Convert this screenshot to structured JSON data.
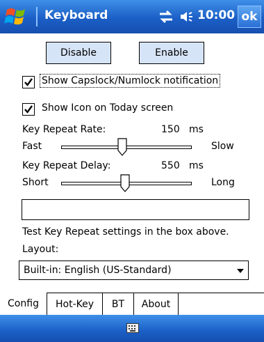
{
  "titlebar": {
    "title": "Keyboard",
    "time": "10:00",
    "ok_label": "ok",
    "icons": [
      "windows-start-icon",
      "connectivity-icon",
      "speaker-icon"
    ]
  },
  "buttons": {
    "disable": "Disable",
    "enable": "Enable"
  },
  "checkboxes": [
    {
      "label": "Show Capslock/Numlock notification",
      "checked": true
    },
    {
      "label": "Show Icon on Today screen",
      "checked": true
    }
  ],
  "repeat_rate": {
    "label": "Key Repeat Rate:",
    "value": "150",
    "unit": "ms",
    "min_label": "Fast",
    "max_label": "Slow",
    "level": 0.47
  },
  "repeat_delay": {
    "label": "Key Repeat Delay:",
    "value": "550",
    "unit": "ms",
    "min_label": "Short",
    "max_label": "Long",
    "level": 0.49
  },
  "test_box": {
    "value": "",
    "hint": "Test Key Repeat settings in the box above."
  },
  "layout": {
    "label": "Layout:",
    "selected": "Built-in: English (US-Standard)"
  },
  "tabs": [
    {
      "label": "Config",
      "active": true
    },
    {
      "label": "Hot-Key",
      "active": false
    },
    {
      "label": "BT",
      "active": false
    },
    {
      "label": "About",
      "active": false
    }
  ],
  "menubar": {
    "icon": "keyboard-icon"
  },
  "colors": {
    "titlebar": "#1b5fc6",
    "button_face": "#d6e4f7"
  }
}
